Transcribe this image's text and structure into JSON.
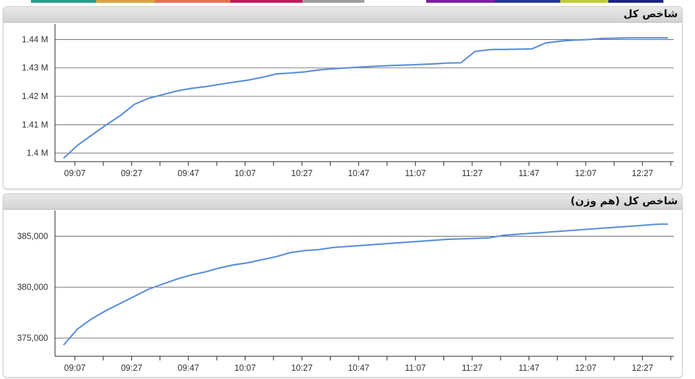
{
  "top_strip_colors": [
    "#2a9d8f",
    "#d9a441",
    "#e76f51",
    "#c2185b",
    "#9e9e9e",
    "#ffffff",
    "#7b1fa2",
    "#283593",
    "#c0ca33",
    "#1a237e"
  ],
  "line_color": "#5b8fd9",
  "panels": [
    {
      "title": "شاخص کل",
      "chart_data": {
        "type": "line",
        "title": "شاخص کل",
        "xlabel": "",
        "ylabel": "",
        "x_ticks": [
          "09:07",
          "09:27",
          "09:47",
          "10:07",
          "10:27",
          "10:47",
          "11:07",
          "11:27",
          "11:47",
          "12:07",
          "12:27"
        ],
        "x_range": [
          "09:00",
          "12:38"
        ],
        "y_ticks": [
          1400000,
          1410000,
          1420000,
          1430000,
          1440000
        ],
        "y_tick_labels": [
          "1.4 M",
          "1.41 M",
          "1.42 M",
          "1.43 M",
          "1.44 M"
        ],
        "ylim": [
          1397000,
          1443500
        ],
        "grid": true,
        "series": [
          {
            "x": [
              "09:03",
              "09:08",
              "09:13",
              "09:18",
              "09:23",
              "09:28",
              "09:33",
              "09:38",
              "09:43",
              "09:48",
              "09:53",
              "09:58",
              "10:03",
              "10:08",
              "10:13",
              "10:18",
              "10:23",
              "10:28",
              "10:33",
              "10:38",
              "10:43",
              "10:48",
              "10:53",
              "10:58",
              "11:03",
              "11:08",
              "11:13",
              "11:18",
              "11:23",
              "11:28",
              "11:33",
              "11:35",
              "11:38",
              "11:43",
              "11:48",
              "11:53",
              "11:58",
              "12:00",
              "12:03",
              "12:08",
              "12:13",
              "12:18",
              "12:23",
              "12:28",
              "12:33",
              "12:36"
            ],
            "values": [
              1398200,
              1402800,
              1406400,
              1409900,
              1413200,
              1417200,
              1419300,
              1420600,
              1421900,
              1422800,
              1423400,
              1424200,
              1425000,
              1425700,
              1426700,
              1427900,
              1428200,
              1428600,
              1429300,
              1429700,
              1430000,
              1430300,
              1430600,
              1430800,
              1431000,
              1431200,
              1431400,
              1431700,
              1431800,
              1435800,
              1436400,
              1436500,
              1436500,
              1436600,
              1436700,
              1438800,
              1439400,
              1439600,
              1439800,
              1440000,
              1440400,
              1440500,
              1440600,
              1440600,
              1440600,
              1440600
            ]
          }
        ]
      }
    },
    {
      "title": "شاخص کل (هم وزن)",
      "chart_data": {
        "type": "line",
        "title": "شاخص کل (هم وزن)",
        "xlabel": "",
        "ylabel": "",
        "x_ticks": [
          "09:07",
          "09:27",
          "09:47",
          "10:07",
          "10:27",
          "10:47",
          "11:07",
          "11:27",
          "11:47",
          "12:07",
          "12:27"
        ],
        "x_range": [
          "09:00",
          "12:38"
        ],
        "y_ticks": [
          375000,
          380000,
          385000
        ],
        "y_tick_labels": [
          "375,000",
          "380,000",
          "385,000"
        ],
        "ylim": [
          373200,
          387000
        ],
        "grid": true,
        "series": [
          {
            "x": [
              "09:03",
              "09:08",
              "09:13",
              "09:18",
              "09:23",
              "09:28",
              "09:33",
              "09:38",
              "09:43",
              "09:48",
              "09:53",
              "09:58",
              "10:03",
              "10:08",
              "10:13",
              "10:18",
              "10:23",
              "10:28",
              "10:33",
              "10:38",
              "10:43",
              "10:48",
              "10:53",
              "10:58",
              "11:03",
              "11:08",
              "11:13",
              "11:18",
              "11:23",
              "11:28",
              "11:33",
              "11:38",
              "11:43",
              "11:48",
              "11:53",
              "11:58",
              "12:03",
              "12:08",
              "12:13",
              "12:18",
              "12:23",
              "12:28",
              "12:33",
              "12:36"
            ],
            "values": [
              374300,
              375900,
              376900,
              377700,
              378400,
              379100,
              379800,
              380300,
              380800,
              381200,
              381500,
              381900,
              382200,
              382400,
              382700,
              383000,
              383400,
              383600,
              383700,
              383900,
              384000,
              384100,
              384200,
              384300,
              384400,
              384500,
              384600,
              384700,
              384750,
              384800,
              384850,
              385100,
              385200,
              385300,
              385400,
              385500,
              385600,
              385700,
              385800,
              385900,
              386000,
              386100,
              386200,
              386200
            ]
          }
        ]
      }
    }
  ]
}
